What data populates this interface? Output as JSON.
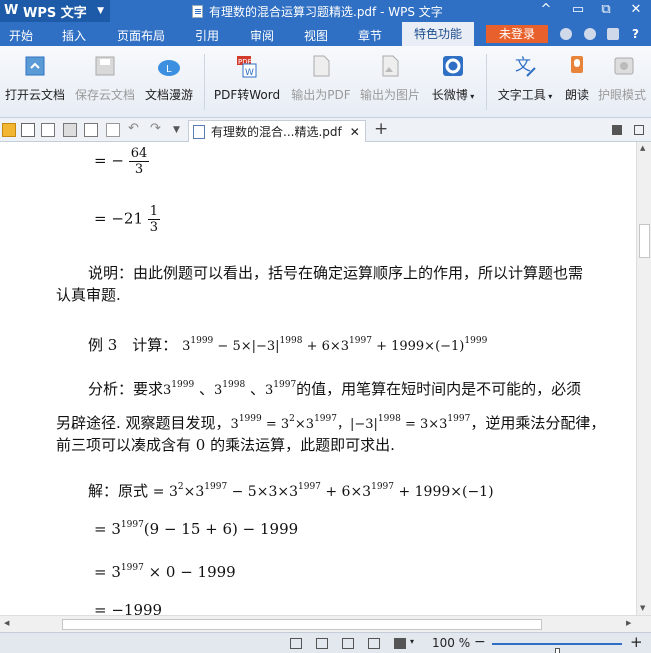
{
  "app": {
    "name": "WPS 文字",
    "doc_title": "有理数的混合运算习题精选.pdf - WPS 文字"
  },
  "window": {
    "up_icon": "^",
    "min_icon": "▭",
    "restore_icon": "⧉",
    "close_icon": "✕"
  },
  "menu": {
    "items": [
      "开始",
      "插入",
      "页面布局",
      "引用",
      "审阅",
      "视图",
      "章节",
      "特色功能"
    ],
    "login": "未登录",
    "help": "?"
  },
  "ribbon": {
    "buttons": [
      "打开云文档",
      "保存云文档",
      "文档漫游",
      "PDF转Word",
      "输出为PDF",
      "输出为图片",
      "长微博",
      "文字工具",
      "朗读",
      "护眼模式"
    ]
  },
  "tabs": {
    "doc_tab": "有理数的混合...精选.pdf"
  },
  "document": {
    "l1_prefix": "= −",
    "l1_num": "64",
    "l1_den": "3",
    "l2_prefix": "= −21",
    "l2_num": "1",
    "l2_den": "3",
    "explain1": "说明：由此例题可以看出，括号在确定运算顺序上的作用，所以计算题也需",
    "explain2": "认真审题.",
    "ex3_label": "例 3　计算：",
    "analysis_a": "分析：要求",
    "analysis_b": "、",
    "analysis_c": "的值，用笔算在短时间内是不可能的，必须",
    "analysis2_a": "另辟途径. 观察题目发现，",
    "analysis2_b": "，逆用乘法分配律，",
    "analysis3": "前三项可以凑成含有 0 的乘法运算，此题即可求出.",
    "sol_label": "解：原式",
    "step1": "= 3",
    "step1_exp": "1997",
    "step1_rest": "(9 − 15 + 6) − 1999",
    "step2": "= 3",
    "step2_exp": "1997",
    "step2_rest": " × 0 − 1999",
    "step3": "= −1999"
  },
  "status": {
    "zoom": "100 %"
  }
}
